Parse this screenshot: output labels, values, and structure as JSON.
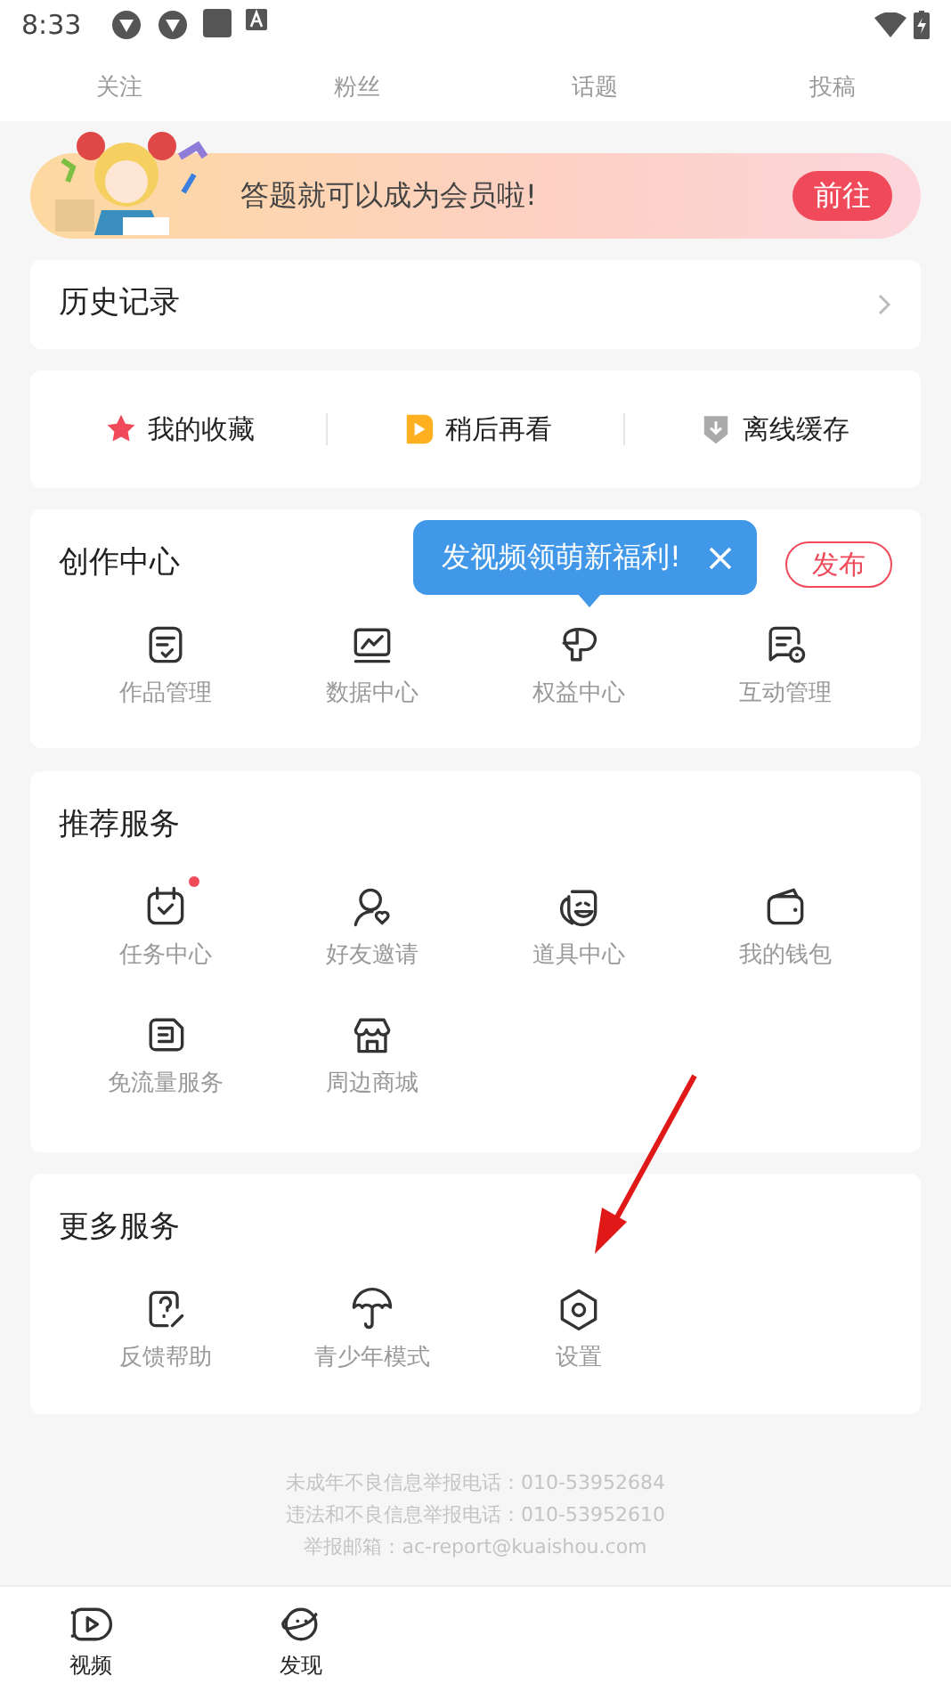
{
  "status_bar": {
    "time": "8:33"
  },
  "stats": [
    {
      "label": "关注"
    },
    {
      "label": "粉丝"
    },
    {
      "label": "话题"
    },
    {
      "label": "投稿"
    }
  ],
  "banner": {
    "kind": "picture",
    "text": "答题就可以成为会员啦!",
    "button": "前往"
  },
  "history": {
    "title": "历史记录"
  },
  "shortcuts": [
    {
      "label": "我的收藏",
      "kind": "star"
    },
    {
      "label": "稍后再看",
      "kind": "play"
    },
    {
      "label": "离线缓存",
      "kind": "download"
    }
  ],
  "creation": {
    "title": "创作中心",
    "publish_button": "发布",
    "tooltip": {
      "text": "发视频领萌新福利!"
    },
    "items": [
      {
        "label": "作品管理",
        "kind": "works"
      },
      {
        "label": "数据中心",
        "kind": "chart"
      },
      {
        "label": "权益中心",
        "kind": "rights"
      },
      {
        "label": "互动管理",
        "kind": "interact"
      }
    ]
  },
  "recommended": {
    "title": "推荐服务",
    "items": [
      {
        "label": "任务中心",
        "kind": "calendar",
        "dot": true
      },
      {
        "label": "好友邀请",
        "kind": "friend",
        "dot": false
      },
      {
        "label": "道具中心",
        "kind": "mask",
        "dot": false
      },
      {
        "label": "我的钱包",
        "kind": "wallet",
        "dot": false
      },
      {
        "label": "免流量服务",
        "kind": "sim",
        "dot": false
      },
      {
        "label": "周边商城",
        "kind": "shop",
        "dot": false
      }
    ]
  },
  "more": {
    "title": "更多服务",
    "items": [
      {
        "label": "反馈帮助",
        "kind": "help"
      },
      {
        "label": "青少年模式",
        "kind": "umbrella"
      },
      {
        "label": "设置",
        "kind": "settings"
      }
    ]
  },
  "footer": [
    "未成年不良信息举报电话：010-53952684",
    "违法和不良信息举报电话：010-53952610",
    "举报邮箱：ac-report@kuaishou.com"
  ],
  "bottom_nav": [
    {
      "label": "视频",
      "kind": "video"
    },
    {
      "label": "发现",
      "kind": "planet"
    }
  ]
}
